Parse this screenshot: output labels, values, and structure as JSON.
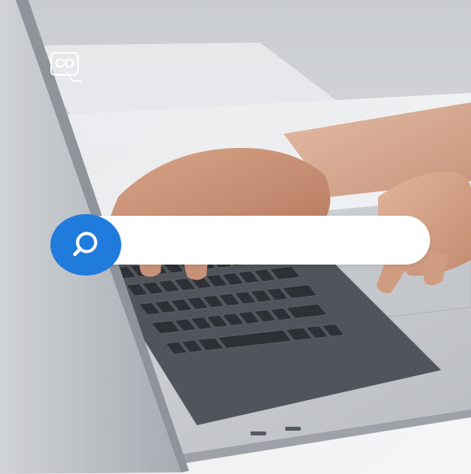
{
  "brand": {
    "logo_text": "CO",
    "accent_color": "#1f7bdc"
  },
  "search": {
    "icon": "search-icon",
    "value": "",
    "placeholder": ""
  },
  "background": {
    "subject": "laptop-keyboard-with-hands"
  }
}
